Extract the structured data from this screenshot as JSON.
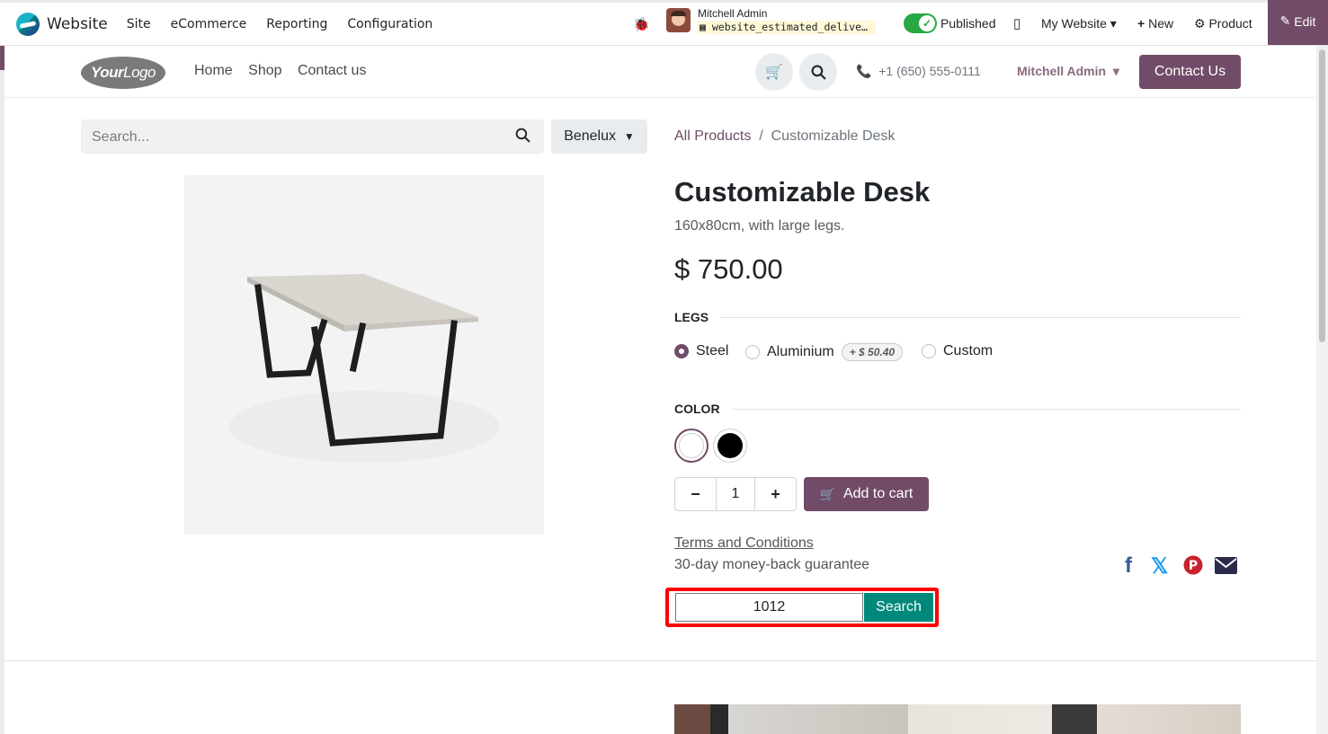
{
  "topbar": {
    "app_name": "Website",
    "menu": [
      "Site",
      "eCommerce",
      "Reporting",
      "Configuration"
    ],
    "user_name": "Mitchell Admin",
    "database": "website_estimated_delive…",
    "published_label": "Published",
    "website_select": "My Website",
    "new_label": "New",
    "product_label": "Product",
    "edit_label": "Edit"
  },
  "nav": {
    "logo_your": "Your",
    "logo_logo": "Logo",
    "links": [
      "Home",
      "Shop",
      "Contact us"
    ],
    "phone": "+1 (650) 555-0111",
    "user": "Mitchell Admin",
    "contact_button": "Contact Us"
  },
  "search": {
    "placeholder": "Search...",
    "pricelist": "Benelux"
  },
  "breadcrumb": {
    "parent": "All Products",
    "separator": "/",
    "current": "Customizable Desk"
  },
  "product": {
    "name": "Customizable Desk",
    "description": "160x80cm, with large legs.",
    "price": "$ 750.00",
    "legs_label": "LEGS",
    "legs_options": [
      {
        "label": "Steel",
        "selected": true
      },
      {
        "label": "Aluminium",
        "extra": "+ $ 50.40"
      },
      {
        "label": "Custom"
      }
    ],
    "color_label": "COLOR",
    "colors": [
      {
        "name": "white",
        "hex": "#ffffff",
        "selected": true
      },
      {
        "name": "black",
        "hex": "#000000"
      }
    ],
    "quantity": "1",
    "add_to_cart": "Add to cart",
    "terms": "Terms and Conditions",
    "guarantee": "30-day money-back guarantee"
  },
  "test_widget": {
    "input_value": "1012",
    "button_label": "Search"
  },
  "colors": {
    "primary": "#714b67",
    "teal": "#00897b",
    "highlight": "#ff0000"
  }
}
